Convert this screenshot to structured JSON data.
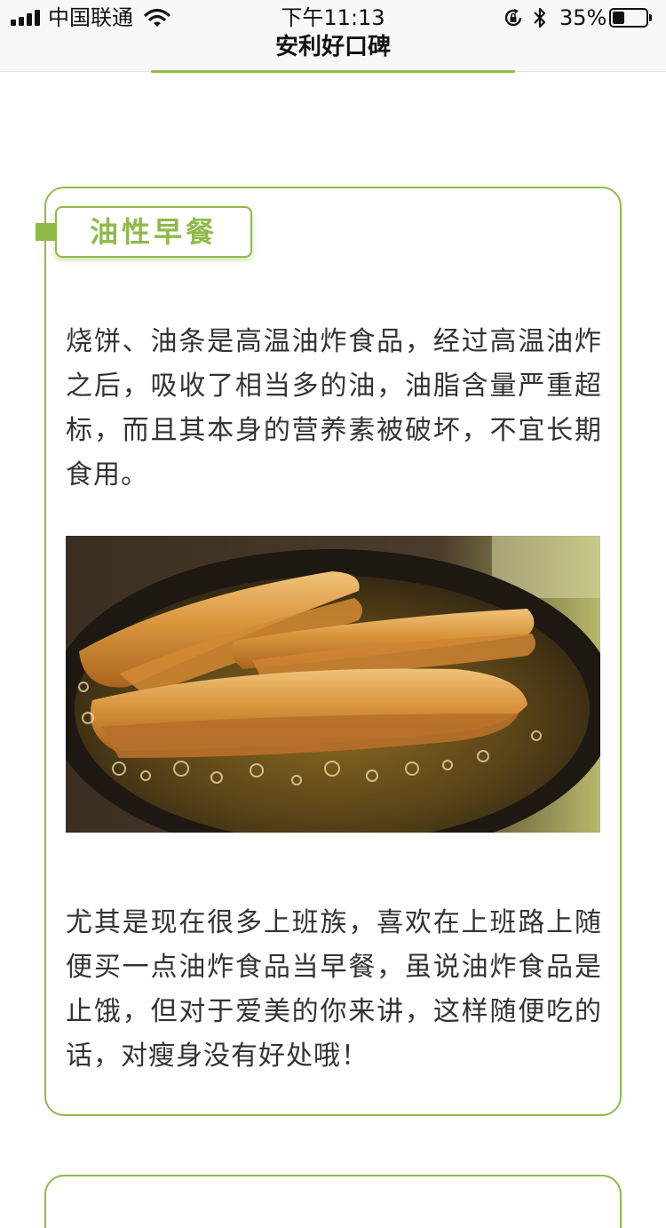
{
  "status_bar": {
    "carrier": "中国联通",
    "time": "下午11:13",
    "battery_percent": "35%",
    "battery_level": 0.35,
    "icons": [
      "signal-icon",
      "wifi-icon",
      "rotation-lock-icon",
      "bluetooth-icon",
      "battery-icon"
    ]
  },
  "nav": {
    "title": "安利好口碑"
  },
  "section": {
    "tag": "油性早餐",
    "paragraph1": "烧饼、油条是高温油炸食品，经过高温油炸之后，吸收了相当多的油，油脂含量严重超标，而且其本身的营养素被破坏，不宜长期食用。",
    "image": "fried-dough-sticks-photo",
    "paragraph2": "尤其是现在很多上班族，喜欢在上班路上随便买一点油炸食品当早餐，虽说油炸食品是止饿，但对于爱美的你来讲，这样随便吃的话，对瘦身没有好处哦！"
  },
  "colors": {
    "accent": "#8fba4a",
    "text": "#333333",
    "statusbar_bg": "#f8f8f8"
  }
}
